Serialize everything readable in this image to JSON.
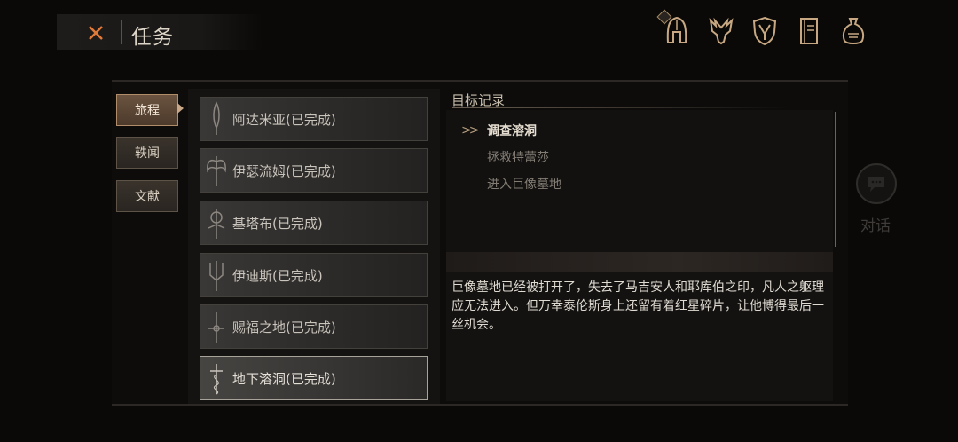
{
  "header": {
    "title": "任务",
    "close_icon": "close-x-icon",
    "accent": "#e07a3a"
  },
  "top_icons": [
    "helmet-icon",
    "beast-crest-icon",
    "shield-emblem-icon",
    "journal-book-icon",
    "coin-bag-icon"
  ],
  "categories": [
    {
      "label": "旅程",
      "active": true
    },
    {
      "label": "轶闻",
      "active": false
    },
    {
      "label": "文献",
      "active": false
    }
  ],
  "quests": [
    {
      "label": "阿达米亚(已完成)",
      "icon": "feather-blade-icon"
    },
    {
      "label": "伊瑟流姆(已完成)",
      "icon": "double-axe-icon"
    },
    {
      "label": "基塔布(已完成)",
      "icon": "ornate-sword-icon"
    },
    {
      "label": "伊迪斯(已完成)",
      "icon": "trident-icon"
    },
    {
      "label": "赐福之地(已完成)",
      "icon": "cross-sword-icon"
    },
    {
      "label": "地下溶洞(已完成)",
      "icon": "serpent-dagger-icon",
      "active": true
    }
  ],
  "objectives": {
    "title": "目标记录",
    "items": [
      {
        "label": "调查溶洞",
        "current": true
      },
      {
        "label": "拯救特蕾莎",
        "current": false
      },
      {
        "label": "进入巨像墓地",
        "current": false
      }
    ]
  },
  "description": "巨像墓地已经被打开了，失去了马吉安人和耶库伯之印，凡人之躯理应无法进入。但万幸泰伦斯身上还留有着红星碎片，让他博得最后一丝机会。",
  "side": {
    "talk_label": "对话",
    "talk_icon": "chat-bubble-icon"
  }
}
